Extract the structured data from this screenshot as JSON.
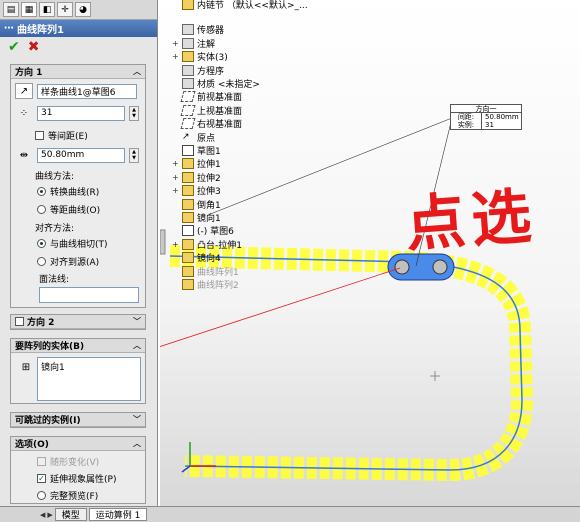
{
  "pm": {
    "title": "曲线阵列1",
    "ok_label": "✔",
    "cancel_label": "✖",
    "tabs": [
      "featuremanager-icon",
      "propertymanager-icon",
      "configuration-icon",
      "dimxpert-icon",
      "display-icon"
    ]
  },
  "direction1": {
    "header": "方向 1",
    "edge": "样条曲线1@草图6",
    "instances": "31",
    "equal_spacing": "等间距(E)",
    "spacing": "50.80mm",
    "curve_method_label": "曲线方法:",
    "curve_method_opt1": "转换曲线(R)",
    "curve_method_opt2": "等距曲线(O)",
    "align_method_label": "对齐方法:",
    "align_method_opt1": "与曲线相切(T)",
    "align_method_opt2": "对齐到源(A)",
    "face_label": "面法线:"
  },
  "direction2": {
    "header": "方向 2"
  },
  "features": {
    "header": "要阵列的实体(B)",
    "item": "镜向1"
  },
  "skip": {
    "header": "可跳过的实例(I)"
  },
  "options": {
    "header": "选项(O)",
    "vary_sketch": "随形变化(V)",
    "propagate": "延伸视象属性(P)",
    "full_preview": "完整预览(F)"
  },
  "bottom_tabs": [
    "模型",
    "运动算例 1"
  ],
  "tree": [
    {
      "label": "内链节 （默认<<默认>_...",
      "icon": "part",
      "plus": ""
    },
    {
      "label": "传感器",
      "icon": "sensor",
      "plus": ""
    },
    {
      "label": "注解",
      "icon": "ann",
      "plus": "+"
    },
    {
      "label": "实体(3)",
      "icon": "part",
      "plus": "+"
    },
    {
      "label": "方程序",
      "icon": "eq",
      "plus": ""
    },
    {
      "label": "材质 <未指定>",
      "icon": "mat",
      "plus": ""
    },
    {
      "label": "前视基准面",
      "icon": "plane",
      "plus": ""
    },
    {
      "label": "上视基准面",
      "icon": "plane",
      "plus": ""
    },
    {
      "label": "右视基准面",
      "icon": "plane",
      "plus": ""
    },
    {
      "label": "原点",
      "icon": "orig",
      "plus": ""
    },
    {
      "label": "草图1",
      "icon": "sketch",
      "plus": ""
    },
    {
      "label": "拉伸1",
      "icon": "part",
      "plus": "+"
    },
    {
      "label": "拉伸2",
      "icon": "part",
      "plus": "+"
    },
    {
      "label": "拉伸3",
      "icon": "part",
      "plus": "+"
    },
    {
      "label": "倒角1",
      "icon": "part",
      "plus": ""
    },
    {
      "label": "镜向1",
      "icon": "part",
      "plus": ""
    },
    {
      "label": "(-) 草图6",
      "icon": "sketch",
      "plus": ""
    },
    {
      "label": "凸台-拉伸1",
      "icon": "part",
      "plus": "+"
    },
    {
      "label": "镜向4",
      "icon": "part",
      "plus": ""
    },
    {
      "label": "曲线阵列1",
      "icon": "part",
      "plus": "",
      "dim": true
    },
    {
      "label": "曲线阵列2",
      "icon": "part",
      "plus": "",
      "dim": true
    }
  ],
  "callout": {
    "title": "方向一",
    "row1_k": "间距:",
    "row1_v": "50.80mm",
    "row2_k": "实例:",
    "row2_v": "31"
  },
  "annotation": "点选",
  "colors": {
    "chain_highlight": "#ffff33",
    "path": "#3a7ad8",
    "annotation": "#e61a1a",
    "title_bar": "#3a64a4"
  }
}
